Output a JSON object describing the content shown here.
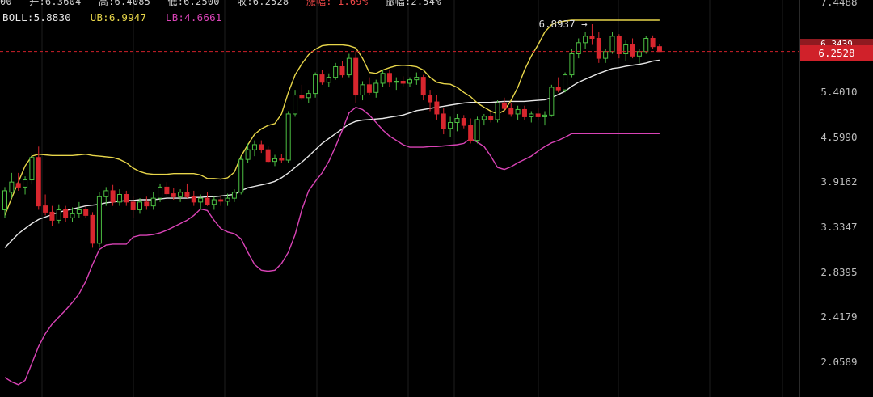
{
  "header": {
    "time_fragment": "00",
    "open": "开:6.3604",
    "high": "高:6.4085",
    "low": "低:6.2500",
    "close": "收:6.2528",
    "change_pct": "涨幅:-1.69%",
    "amplitude": "振幅:2.54%"
  },
  "boll": {
    "mid": "BOLL:5.8830",
    "ub": "UB:6.9947",
    "lb": "LB:4.6661",
    "colors": {
      "mid": "#e8e8e8",
      "ub": "#e8d64a",
      "lb": "#d943b6"
    }
  },
  "current_price": {
    "label": "6.2528",
    "hidden_label": "6.3439",
    "value": 6.2528,
    "color": "#d0212a"
  },
  "max_marker": {
    "label": "6.8937 →",
    "value": 6.8937
  },
  "colors": {
    "up": "#4cbf43",
    "down": "#d8262e",
    "grid": "#1e1e1e",
    "background": "#000000"
  },
  "chart_data": {
    "type": "candlestick",
    "y_axis": {
      "position": "right",
      "ticks": [
        2.0589,
        2.4179,
        2.8395,
        3.3347,
        3.9162,
        4.599,
        5.401,
        6.3439,
        7.4488
      ],
      "tick_labels": [
        "2.0589",
        "2.4179",
        "2.8395",
        "3.3347",
        "3.9162",
        "4.5990",
        "5.4010",
        "6.3439",
        "7.4488"
      ],
      "scale": "log"
    },
    "candles": [
      [
        3.55,
        3.85,
        3.45,
        3.8
      ],
      [
        3.78,
        4.05,
        3.7,
        3.92
      ],
      [
        3.9,
        4.05,
        3.8,
        3.85
      ],
      [
        3.85,
        4.0,
        3.75,
        3.95
      ],
      [
        3.95,
        4.35,
        3.9,
        4.28
      ],
      [
        4.28,
        4.45,
        3.55,
        3.6
      ],
      [
        3.6,
        3.75,
        3.48,
        3.52
      ],
      [
        3.52,
        3.6,
        3.35,
        3.42
      ],
      [
        3.42,
        3.62,
        3.38,
        3.55
      ],
      [
        3.55,
        3.6,
        3.4,
        3.45
      ],
      [
        3.45,
        3.58,
        3.4,
        3.5
      ],
      [
        3.5,
        3.65,
        3.45,
        3.55
      ],
      [
        3.55,
        3.6,
        3.45,
        3.48
      ],
      [
        3.48,
        3.52,
        3.1,
        3.15
      ],
      [
        3.15,
        3.78,
        3.1,
        3.72
      ],
      [
        3.72,
        3.85,
        3.6,
        3.8
      ],
      [
        3.8,
        3.88,
        3.6,
        3.65
      ],
      [
        3.65,
        3.82,
        3.6,
        3.75
      ],
      [
        3.75,
        3.8,
        3.6,
        3.65
      ],
      [
        3.65,
        3.72,
        3.45,
        3.55
      ],
      [
        3.55,
        3.7,
        3.5,
        3.65
      ],
      [
        3.65,
        3.72,
        3.55,
        3.6
      ],
      [
        3.6,
        3.78,
        3.55,
        3.7
      ],
      [
        3.7,
        3.9,
        3.65,
        3.85
      ],
      [
        3.85,
        3.92,
        3.72,
        3.76
      ],
      [
        3.76,
        3.84,
        3.68,
        3.72
      ],
      [
        3.72,
        3.82,
        3.65,
        3.78
      ],
      [
        3.78,
        3.9,
        3.7,
        3.72
      ],
      [
        3.72,
        3.8,
        3.6,
        3.65
      ],
      [
        3.65,
        3.75,
        3.55,
        3.7
      ],
      [
        3.7,
        3.78,
        3.6,
        3.62
      ],
      [
        3.62,
        3.72,
        3.55,
        3.68
      ],
      [
        3.68,
        3.74,
        3.6,
        3.66
      ],
      [
        3.66,
        3.76,
        3.6,
        3.7
      ],
      [
        3.7,
        3.82,
        3.65,
        3.78
      ],
      [
        3.78,
        4.3,
        3.75,
        4.25
      ],
      [
        4.25,
        4.5,
        4.2,
        4.4
      ],
      [
        4.4,
        4.55,
        4.3,
        4.48
      ],
      [
        4.48,
        4.55,
        4.35,
        4.4
      ],
      [
        4.4,
        4.45,
        4.2,
        4.22
      ],
      [
        4.22,
        4.32,
        4.15,
        4.26
      ],
      [
        4.26,
        4.33,
        4.2,
        4.24
      ],
      [
        4.24,
        5.05,
        4.2,
        5.0
      ],
      [
        5.0,
        5.45,
        4.95,
        5.35
      ],
      [
        5.35,
        5.55,
        5.25,
        5.3
      ],
      [
        5.3,
        5.45,
        5.2,
        5.38
      ],
      [
        5.38,
        5.8,
        5.3,
        5.75
      ],
      [
        5.75,
        5.85,
        5.55,
        5.6
      ],
      [
        5.6,
        5.78,
        5.5,
        5.7
      ],
      [
        5.7,
        6.0,
        5.65,
        5.92
      ],
      [
        5.92,
        6.05,
        5.7,
        5.75
      ],
      [
        5.75,
        6.2,
        5.7,
        6.1
      ],
      [
        6.1,
        6.25,
        5.2,
        5.35
      ],
      [
        5.35,
        5.62,
        5.25,
        5.55
      ],
      [
        5.55,
        5.7,
        5.35,
        5.4
      ],
      [
        5.4,
        5.65,
        5.3,
        5.58
      ],
      [
        5.58,
        5.85,
        5.5,
        5.78
      ],
      [
        5.78,
        5.85,
        5.5,
        5.6
      ],
      [
        5.6,
        5.7,
        5.45,
        5.62
      ],
      [
        5.62,
        5.72,
        5.52,
        5.58
      ],
      [
        5.58,
        5.7,
        5.5,
        5.65
      ],
      [
        5.65,
        5.8,
        5.55,
        5.7
      ],
      [
        5.7,
        5.75,
        5.25,
        5.35
      ],
      [
        5.35,
        5.45,
        5.05,
        5.22
      ],
      [
        5.22,
        5.35,
        4.9,
        5.0
      ],
      [
        5.0,
        5.1,
        4.65,
        4.75
      ],
      [
        4.75,
        4.95,
        4.6,
        4.85
      ],
      [
        4.85,
        5.0,
        4.7,
        4.92
      ],
      [
        4.92,
        4.98,
        4.75,
        4.8
      ],
      [
        4.8,
        4.92,
        4.5,
        4.55
      ],
      [
        4.55,
        4.95,
        4.5,
        4.9
      ],
      [
        4.9,
        5.0,
        4.8,
        4.96
      ],
      [
        4.96,
        5.05,
        4.85,
        4.9
      ],
      [
        4.9,
        5.25,
        4.85,
        5.2
      ],
      [
        5.2,
        5.3,
        5.05,
        5.1
      ],
      [
        5.1,
        5.2,
        4.95,
        5.0
      ],
      [
        5.0,
        5.15,
        4.9,
        5.08
      ],
      [
        5.08,
        5.15,
        4.9,
        4.95
      ],
      [
        4.95,
        5.05,
        4.85,
        5.0
      ],
      [
        5.0,
        5.1,
        4.9,
        4.95
      ],
      [
        4.95,
        5.05,
        4.8,
        4.98
      ],
      [
        4.98,
        5.55,
        4.95,
        5.5
      ],
      [
        5.5,
        5.7,
        5.4,
        5.45
      ],
      [
        5.45,
        5.8,
        5.4,
        5.75
      ],
      [
        5.75,
        6.3,
        5.7,
        6.2
      ],
      [
        6.2,
        6.55,
        6.1,
        6.45
      ],
      [
        6.45,
        6.7,
        6.3,
        6.6
      ],
      [
        6.6,
        6.89,
        6.4,
        6.55
      ],
      [
        6.55,
        6.7,
        6.0,
        6.1
      ],
      [
        6.1,
        6.3,
        6.0,
        6.25
      ],
      [
        6.25,
        6.7,
        6.2,
        6.6
      ],
      [
        6.6,
        6.65,
        6.1,
        6.2
      ],
      [
        6.2,
        6.5,
        6.05,
        6.4
      ],
      [
        6.4,
        6.55,
        6.1,
        6.15
      ],
      [
        6.15,
        6.3,
        6.0,
        6.25
      ],
      [
        6.25,
        6.6,
        6.2,
        6.55
      ],
      [
        6.55,
        6.62,
        6.3,
        6.36
      ],
      [
        6.36,
        6.41,
        6.25,
        6.25
      ]
    ],
    "series": [
      {
        "name": "BOLL",
        "values": [
          3.1,
          3.18,
          3.26,
          3.32,
          3.38,
          3.43,
          3.46,
          3.49,
          3.52,
          3.54,
          3.56,
          3.58,
          3.6,
          3.61,
          3.62,
          3.64,
          3.65,
          3.66,
          3.67,
          3.67,
          3.68,
          3.68,
          3.68,
          3.69,
          3.7,
          3.7,
          3.7,
          3.7,
          3.71,
          3.71,
          3.72,
          3.72,
          3.73,
          3.74,
          3.75,
          3.8,
          3.84,
          3.86,
          3.88,
          3.9,
          3.93,
          3.98,
          4.05,
          4.13,
          4.21,
          4.3,
          4.4,
          4.5,
          4.58,
          4.66,
          4.74,
          4.82,
          4.87,
          4.89,
          4.9,
          4.91,
          4.92,
          4.94,
          4.96,
          4.98,
          5.02,
          5.06,
          5.08,
          5.1,
          5.12,
          5.14,
          5.16,
          5.18,
          5.2,
          5.21,
          5.21,
          5.21,
          5.21,
          5.22,
          5.23,
          5.23,
          5.23,
          5.23,
          5.24,
          5.25,
          5.26,
          5.3,
          5.36,
          5.42,
          5.52,
          5.6,
          5.66,
          5.72,
          5.78,
          5.83,
          5.88,
          5.9,
          5.93,
          5.95,
          5.97,
          6.0,
          6.04,
          6.06
        ]
      },
      {
        "name": "UB",
        "values": [
          3.48,
          3.7,
          3.92,
          4.15,
          4.3,
          4.33,
          4.32,
          4.31,
          4.31,
          4.31,
          4.31,
          4.32,
          4.33,
          4.31,
          4.3,
          4.29,
          4.28,
          4.25,
          4.2,
          4.12,
          4.07,
          4.04,
          4.03,
          4.03,
          4.03,
          4.04,
          4.04,
          4.04,
          4.04,
          4.02,
          3.97,
          3.97,
          3.96,
          3.98,
          4.06,
          4.3,
          4.48,
          4.65,
          4.74,
          4.8,
          4.83,
          5.0,
          5.4,
          5.75,
          5.98,
          6.18,
          6.3,
          6.38,
          6.4,
          6.4,
          6.4,
          6.38,
          6.33,
          6.1,
          5.8,
          5.78,
          5.85,
          5.9,
          5.94,
          5.95,
          5.94,
          5.92,
          5.85,
          5.7,
          5.6,
          5.57,
          5.56,
          5.5,
          5.4,
          5.32,
          5.2,
          5.12,
          5.05,
          5.0,
          5.06,
          5.25,
          5.5,
          5.85,
          6.15,
          6.4,
          6.7,
          6.88,
          6.94,
          6.97,
          6.99,
          6.99,
          6.99,
          6.99,
          6.99,
          6.99,
          6.99,
          6.99,
          6.99,
          6.99,
          6.99,
          6.99,
          6.99,
          6.99
        ]
      },
      {
        "name": "LB",
        "values": [
          1.95,
          1.92,
          1.9,
          1.93,
          2.05,
          2.18,
          2.28,
          2.36,
          2.42,
          2.48,
          2.55,
          2.63,
          2.75,
          2.92,
          3.08,
          3.13,
          3.14,
          3.14,
          3.14,
          3.22,
          3.24,
          3.24,
          3.25,
          3.27,
          3.3,
          3.34,
          3.38,
          3.42,
          3.48,
          3.56,
          3.54,
          3.42,
          3.32,
          3.28,
          3.26,
          3.2,
          3.05,
          2.92,
          2.86,
          2.85,
          2.86,
          2.93,
          3.05,
          3.25,
          3.55,
          3.8,
          3.93,
          4.05,
          4.22,
          4.45,
          4.72,
          5.02,
          5.12,
          5.08,
          4.98,
          4.85,
          4.72,
          4.62,
          4.55,
          4.48,
          4.44,
          4.44,
          4.44,
          4.45,
          4.45,
          4.46,
          4.47,
          4.48,
          4.5,
          4.58,
          4.52,
          4.45,
          4.3,
          4.13,
          4.1,
          4.14,
          4.2,
          4.25,
          4.3,
          4.38,
          4.45,
          4.51,
          4.55,
          4.6,
          4.66,
          4.66,
          4.66,
          4.66,
          4.66,
          4.66,
          4.66,
          4.66,
          4.66,
          4.66,
          4.66,
          4.66,
          4.66,
          4.66
        ]
      }
    ]
  }
}
